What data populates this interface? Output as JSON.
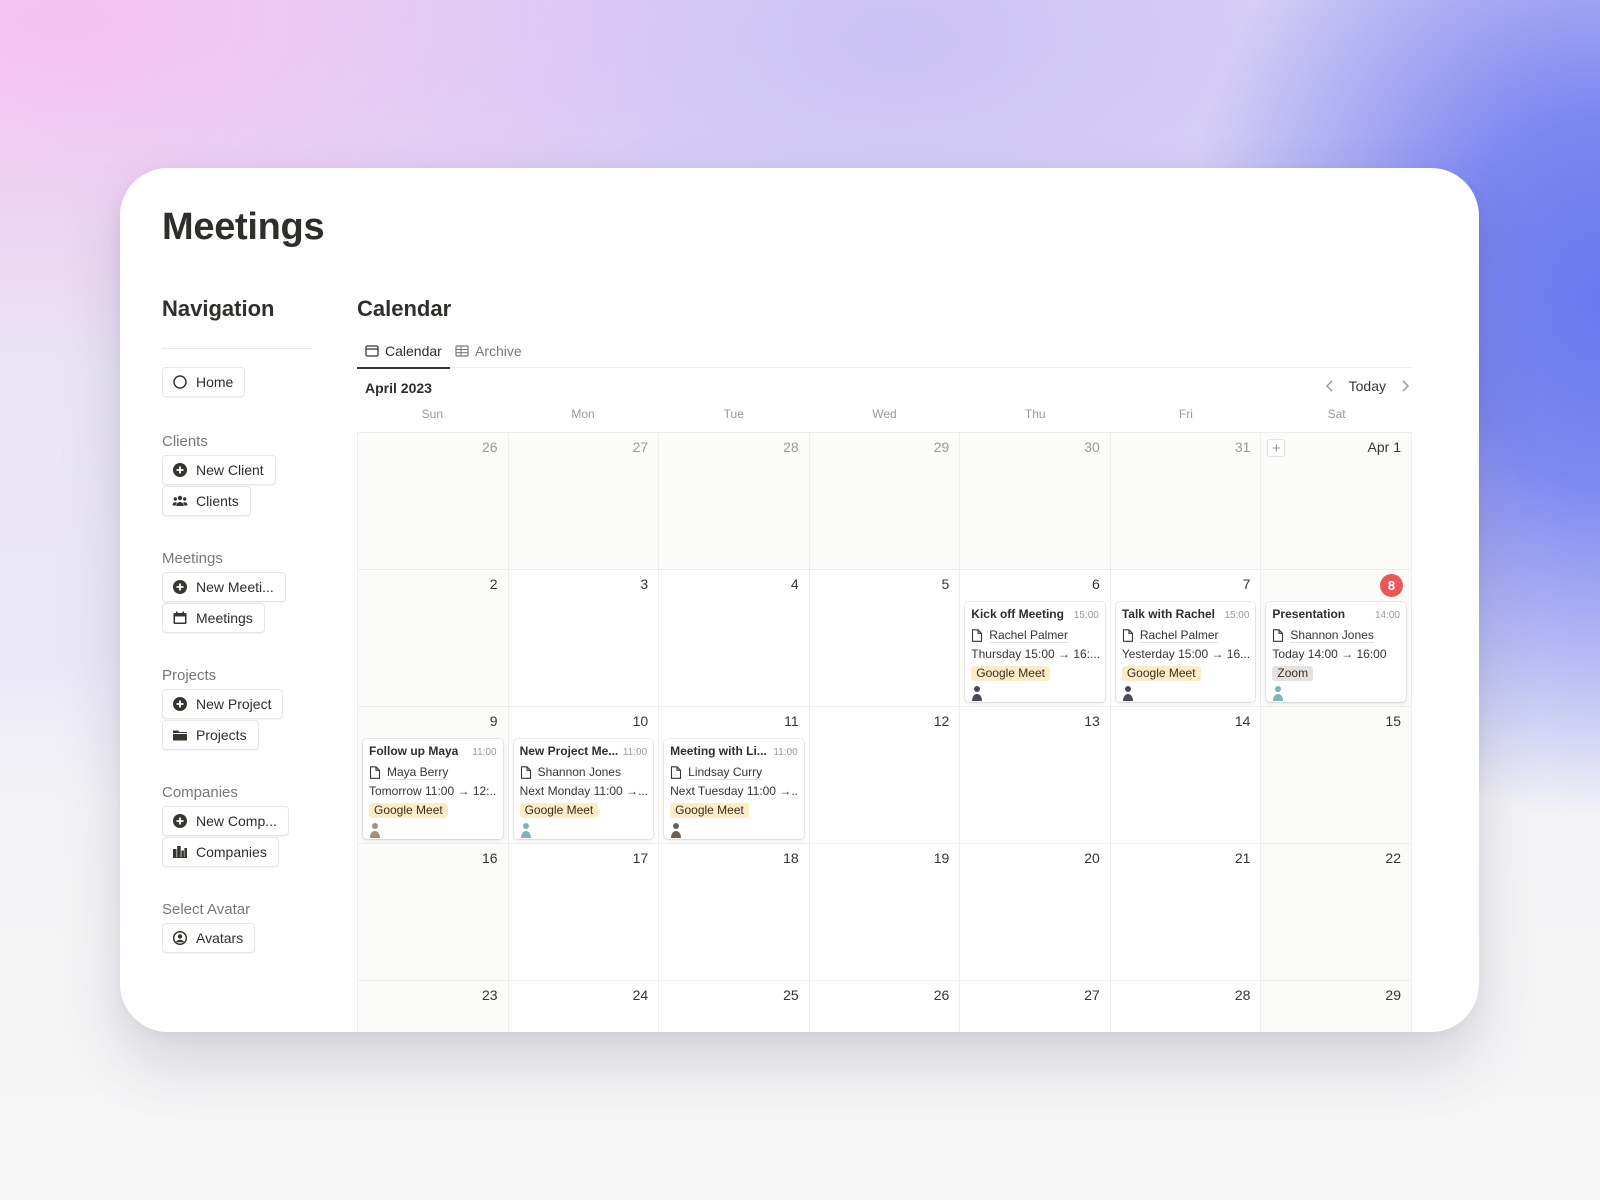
{
  "page": {
    "title": "Meetings"
  },
  "navigation": {
    "title": "Navigation",
    "home": {
      "label": "Home",
      "icon": "circle-icon"
    },
    "groups": [
      {
        "label": "Clients",
        "buttons": [
          {
            "label": "New Client",
            "icon": "plus-circle-icon"
          },
          {
            "label": "Clients",
            "icon": "people-icon"
          }
        ]
      },
      {
        "label": "Meetings",
        "buttons": [
          {
            "label": "New Meeti...",
            "icon": "plus-circle-icon"
          },
          {
            "label": "Meetings",
            "icon": "calendar-icon"
          }
        ]
      },
      {
        "label": "Projects",
        "buttons": [
          {
            "label": "New Project",
            "icon": "plus-circle-icon"
          },
          {
            "label": "Projects",
            "icon": "folder-icon"
          }
        ]
      },
      {
        "label": "Companies",
        "buttons": [
          {
            "label": "New Comp...",
            "icon": "plus-circle-icon"
          },
          {
            "label": "Companies",
            "icon": "buildings-icon"
          }
        ]
      },
      {
        "label": "Select Avatar",
        "buttons": [
          {
            "label": "Avatars",
            "icon": "user-circle-icon"
          }
        ]
      }
    ]
  },
  "calendar": {
    "title": "Calendar",
    "tabs": [
      {
        "label": "Calendar",
        "icon": "calendar-view-icon",
        "active": true
      },
      {
        "label": "Archive",
        "icon": "table-icon",
        "active": false
      }
    ],
    "month_label": "April 2023",
    "today_label": "Today",
    "weekdays": [
      "Sun",
      "Mon",
      "Tue",
      "Wed",
      "Thu",
      "Fri",
      "Sat"
    ],
    "today_color": "#eb5757",
    "weeks": [
      [
        {
          "d": "26",
          "out": true
        },
        {
          "d": "27",
          "out": true
        },
        {
          "d": "28",
          "out": true
        },
        {
          "d": "29",
          "out": true
        },
        {
          "d": "30",
          "out": true
        },
        {
          "d": "31",
          "out": true
        },
        {
          "d": "Apr 1",
          "add": true
        }
      ],
      [
        {
          "d": "2"
        },
        {
          "d": "3"
        },
        {
          "d": "4"
        },
        {
          "d": "5"
        },
        {
          "d": "6",
          "event": {
            "title": "Kick off Meeting",
            "time": "15:00",
            "person": "Rachel Palmer",
            "when": "Thursday 15:00 → 16:...",
            "tag": "Google Meet",
            "tag_color": "#fdecc8",
            "avatar": "#4a4a5a"
          }
        },
        {
          "d": "7",
          "event": {
            "title": "Talk with Rachel",
            "time": "15:00",
            "person": "Rachel Palmer",
            "when": "Yesterday 15:00 → 16...",
            "tag": "Google Meet",
            "tag_color": "#fdecc8",
            "avatar": "#4a4a5a"
          }
        },
        {
          "d": "8",
          "today": true,
          "event": {
            "title": "Presentation",
            "time": "14:00",
            "person": "Shannon Jones",
            "when": "Today 14:00 → 16:00",
            "tag": "Zoom",
            "tag_color": "#e3e2e0",
            "avatar": "#7fb3b8"
          }
        }
      ],
      [
        {
          "d": "9",
          "event": {
            "title": "Follow up Maya",
            "time": "11:00",
            "person": "Maya Berry",
            "when": "Tomorrow 11:00 → 12:...",
            "tag": "Google Meet",
            "tag_color": "#fdecc8",
            "avatar": "#a09080"
          }
        },
        {
          "d": "10",
          "event": {
            "title": "New Project Me...",
            "time": "11:00",
            "person": "Shannon Jones",
            "when": "Next Monday 11:00 →...",
            "tag": "Google Meet",
            "tag_color": "#fdecc8",
            "avatar": "#7fb3b8"
          }
        },
        {
          "d": "11",
          "event": {
            "title": "Meeting with Li...",
            "time": "11:00",
            "person": "Lindsay Curry",
            "when": "Next Tuesday 11:00 →...",
            "tag": "Google Meet",
            "tag_color": "#fdecc8",
            "avatar": "#6a6058"
          }
        },
        {
          "d": "12"
        },
        {
          "d": "13"
        },
        {
          "d": "14"
        },
        {
          "d": "15"
        }
      ],
      [
        {
          "d": "16"
        },
        {
          "d": "17"
        },
        {
          "d": "18"
        },
        {
          "d": "19"
        },
        {
          "d": "20"
        },
        {
          "d": "21"
        },
        {
          "d": "22"
        }
      ],
      [
        {
          "d": "23"
        },
        {
          "d": "24"
        },
        {
          "d": "25"
        },
        {
          "d": "26"
        },
        {
          "d": "27"
        },
        {
          "d": "28"
        },
        {
          "d": "29"
        }
      ]
    ]
  }
}
